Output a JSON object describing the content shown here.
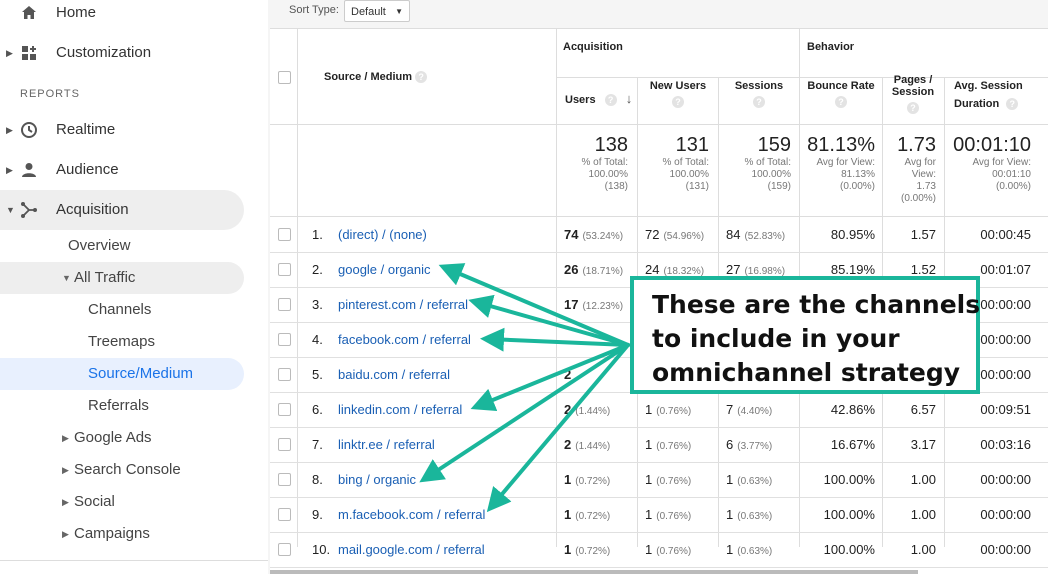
{
  "sidebar": {
    "home": "Home",
    "customization": "Customization",
    "reports_header": "REPORTS",
    "realtime": "Realtime",
    "audience": "Audience",
    "acquisition": "Acquisition",
    "overview": "Overview",
    "all_traffic": "All Traffic",
    "channels": "Channels",
    "treemaps": "Treemaps",
    "source_medium": "Source/Medium",
    "referrals": "Referrals",
    "google_ads": "Google Ads",
    "search_console": "Search Console",
    "social": "Social",
    "campaigns": "Campaigns"
  },
  "sort": {
    "label": "Sort Type:",
    "value": "Default"
  },
  "headers": {
    "source_medium": "Source / Medium",
    "acquisition": "Acquisition",
    "behavior": "Behavior",
    "users": "Users",
    "new_users": "New Users",
    "sessions": "Sessions",
    "bounce_rate": "Bounce Rate",
    "pages_session": "Pages / Session",
    "avg_session_duration_1": "Avg. Session",
    "avg_session_duration_2": "Duration",
    "help": "?"
  },
  "totals": {
    "users": {
      "value": "138",
      "l1": "% of Total:",
      "l2": "100.00%",
      "l3": "(138)"
    },
    "new_users": {
      "value": "131",
      "l1": "% of Total:",
      "l2": "100.00%",
      "l3": "(131)"
    },
    "sessions": {
      "value": "159",
      "l1": "% of Total:",
      "l2": "100.00%",
      "l3": "(159)"
    },
    "bounce_rate": {
      "value": "81.13%",
      "l1": "Avg for View:",
      "l2": "81.13%",
      "l3": "(0.00%)"
    },
    "pages_session": {
      "value": "1.73",
      "l1": "Avg for",
      "l2": "View:",
      "l3": "1.73",
      "l4": "(0.00%)"
    },
    "duration": {
      "value": "00:01:10",
      "l1": "Avg for View:",
      "l2": "00:01:10",
      "l3": "(0.00%)"
    }
  },
  "rows": [
    {
      "n": "1.",
      "source": "(direct) / (none)",
      "users": "74",
      "users_pct": "(53.24%)",
      "new": "72",
      "new_pct": "(54.96%)",
      "sess": "84",
      "sess_pct": "(52.83%)",
      "bounce": "80.95%",
      "pages": "1.57",
      "dur": "00:00:45"
    },
    {
      "n": "2.",
      "source": "google / organic",
      "users": "26",
      "users_pct": "(18.71%)",
      "new": "24",
      "new_pct": "(18.32%)",
      "sess": "27",
      "sess_pct": "(16.98%)",
      "bounce": "85.19%",
      "pages": "1.52",
      "dur": "00:01:07"
    },
    {
      "n": "3.",
      "source": "pinterest.com / referral",
      "users": "17",
      "users_pct": "(12.23%)",
      "new": "",
      "new_pct": "",
      "sess": "",
      "sess_pct": "",
      "bounce": "",
      "pages": "",
      "dur": "00:00:00"
    },
    {
      "n": "4.",
      "source": "facebook.com / referral",
      "users": "",
      "users_pct": "",
      "new": "",
      "new_pct": "",
      "sess": "",
      "sess_pct": "",
      "bounce": "",
      "pages": "",
      "dur": "00:00:00"
    },
    {
      "n": "5.",
      "source": "baidu.com / referral",
      "users": "2",
      "users_pct": "",
      "new": "",
      "new_pct": "",
      "sess": "",
      "sess_pct": "",
      "bounce": "",
      "pages": "",
      "dur": "00:00:00"
    },
    {
      "n": "6.",
      "source": "linkedin.com / referral",
      "users": "2",
      "users_pct": "(1.44%)",
      "new": "1",
      "new_pct": "(0.76%)",
      "sess": "7",
      "sess_pct": "(4.40%)",
      "bounce": "42.86%",
      "pages": "6.57",
      "dur": "00:09:51"
    },
    {
      "n": "7.",
      "source": "linktr.ee / referral",
      "users": "2",
      "users_pct": "(1.44%)",
      "new": "1",
      "new_pct": "(0.76%)",
      "sess": "6",
      "sess_pct": "(3.77%)",
      "bounce": "16.67%",
      "pages": "3.17",
      "dur": "00:03:16"
    },
    {
      "n": "8.",
      "source": "bing / organic",
      "users": "1",
      "users_pct": "(0.72%)",
      "new": "1",
      "new_pct": "(0.76%)",
      "sess": "1",
      "sess_pct": "(0.63%)",
      "bounce": "100.00%",
      "pages": "1.00",
      "dur": "00:00:00"
    },
    {
      "n": "9.",
      "source": "m.facebook.com / referral",
      "users": "1",
      "users_pct": "(0.72%)",
      "new": "1",
      "new_pct": "(0.76%)",
      "sess": "1",
      "sess_pct": "(0.63%)",
      "bounce": "100.00%",
      "pages": "1.00",
      "dur": "00:00:00"
    },
    {
      "n": "10.",
      "source": "mail.google.com / referral",
      "users": "1",
      "users_pct": "(0.72%)",
      "new": "1",
      "new_pct": "(0.76%)",
      "sess": "1",
      "sess_pct": "(0.63%)",
      "bounce": "100.00%",
      "pages": "1.00",
      "dur": "00:00:00"
    }
  ],
  "callout": {
    "line1": "These are the channels",
    "line2": "to include in your",
    "line3": "omnichannel strategy",
    "color": "#1ab69b"
  }
}
